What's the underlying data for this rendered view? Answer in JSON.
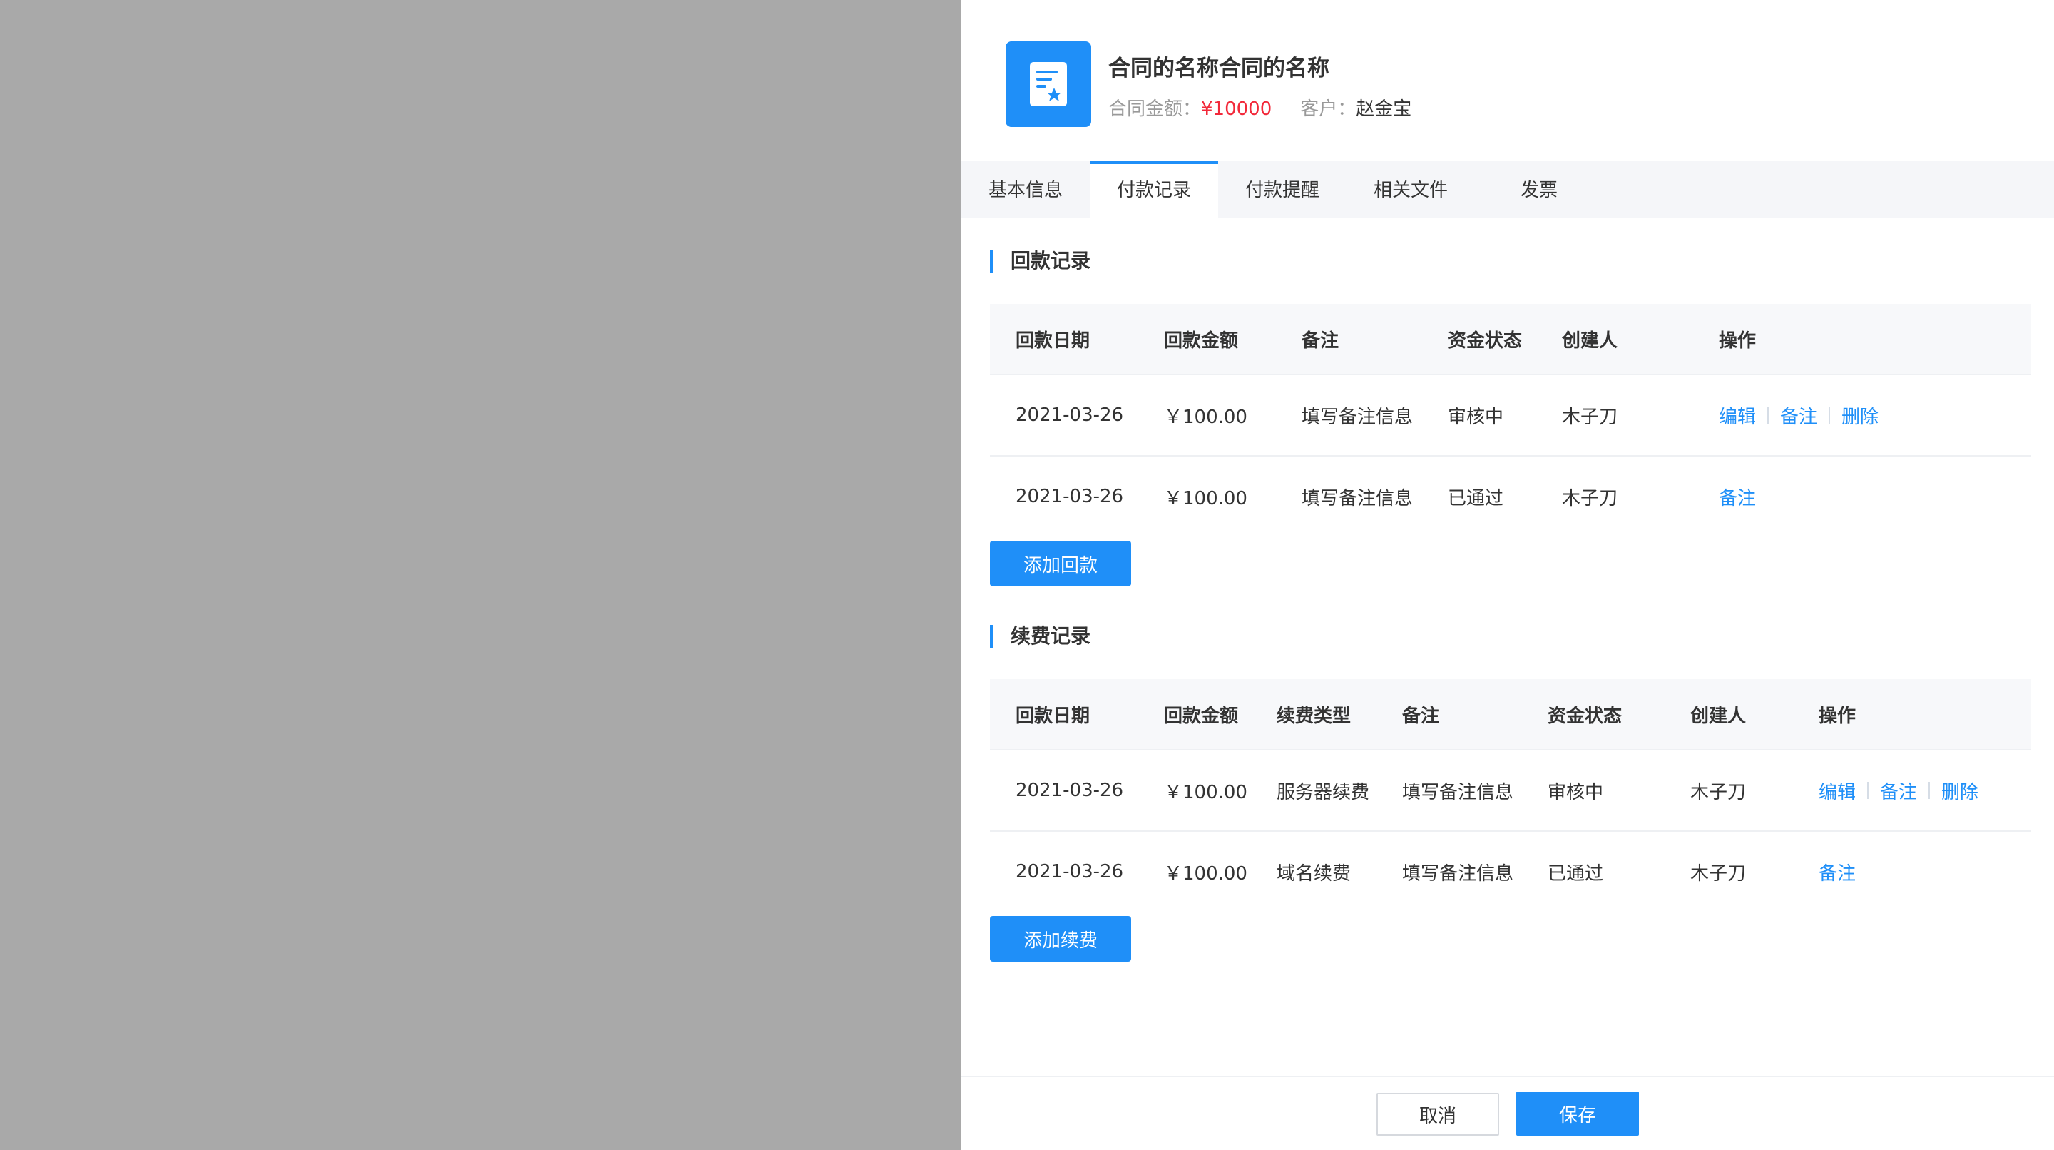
{
  "header": {
    "title": "合同的名称合同的名称",
    "amount_label": "合同金额：",
    "amount_value": "¥10000",
    "customer_label": "客户：",
    "customer_value": "赵金宝",
    "icon": "contract-document-icon"
  },
  "tabs": [
    {
      "label": "基本信息"
    },
    {
      "label": "付款记录"
    },
    {
      "label": "付款提醒"
    },
    {
      "label": "相关文件"
    },
    {
      "label": "发票"
    }
  ],
  "payment": {
    "title": "回款记录",
    "headers": [
      "回款日期",
      "回款金额",
      "备注",
      "资金状态",
      "创建人",
      "操作"
    ],
    "rows": [
      {
        "date": "2021-03-26",
        "amount": "￥100.00",
        "note": "填写备注信息",
        "status": "审核中",
        "creator": "木子刀",
        "actions": [
          "编辑",
          "备注",
          "删除"
        ]
      },
      {
        "date": "2021-03-26",
        "amount": "￥100.00",
        "note": "填写备注信息",
        "status": "已通过",
        "creator": "木子刀",
        "actions": [
          "备注"
        ]
      }
    ],
    "add_label": "添加回款"
  },
  "renewal": {
    "title": "续费记录",
    "headers": [
      "回款日期",
      "回款金额",
      "续费类型",
      "备注",
      "资金状态",
      "创建人",
      "操作"
    ],
    "rows": [
      {
        "date": "2021-03-26",
        "amount": "￥100.00",
        "type": "服务器续费",
        "note": "填写备注信息",
        "status": "审核中",
        "creator": "木子刀",
        "actions": [
          "编辑",
          "备注",
          "删除"
        ]
      },
      {
        "date": "2021-03-26",
        "amount": "￥100.00",
        "type": "域名续费",
        "note": "填写备注信息",
        "status": "已通过",
        "creator": "木子刀",
        "actions": [
          "备注"
        ]
      }
    ],
    "add_label": "添加续费"
  },
  "footer": {
    "cancel_label": "取消",
    "save_label": "保存"
  },
  "colors": {
    "accent": "#1f8ff8",
    "amount_red": "#f2293a",
    "overlay": "#a9a9a9"
  }
}
